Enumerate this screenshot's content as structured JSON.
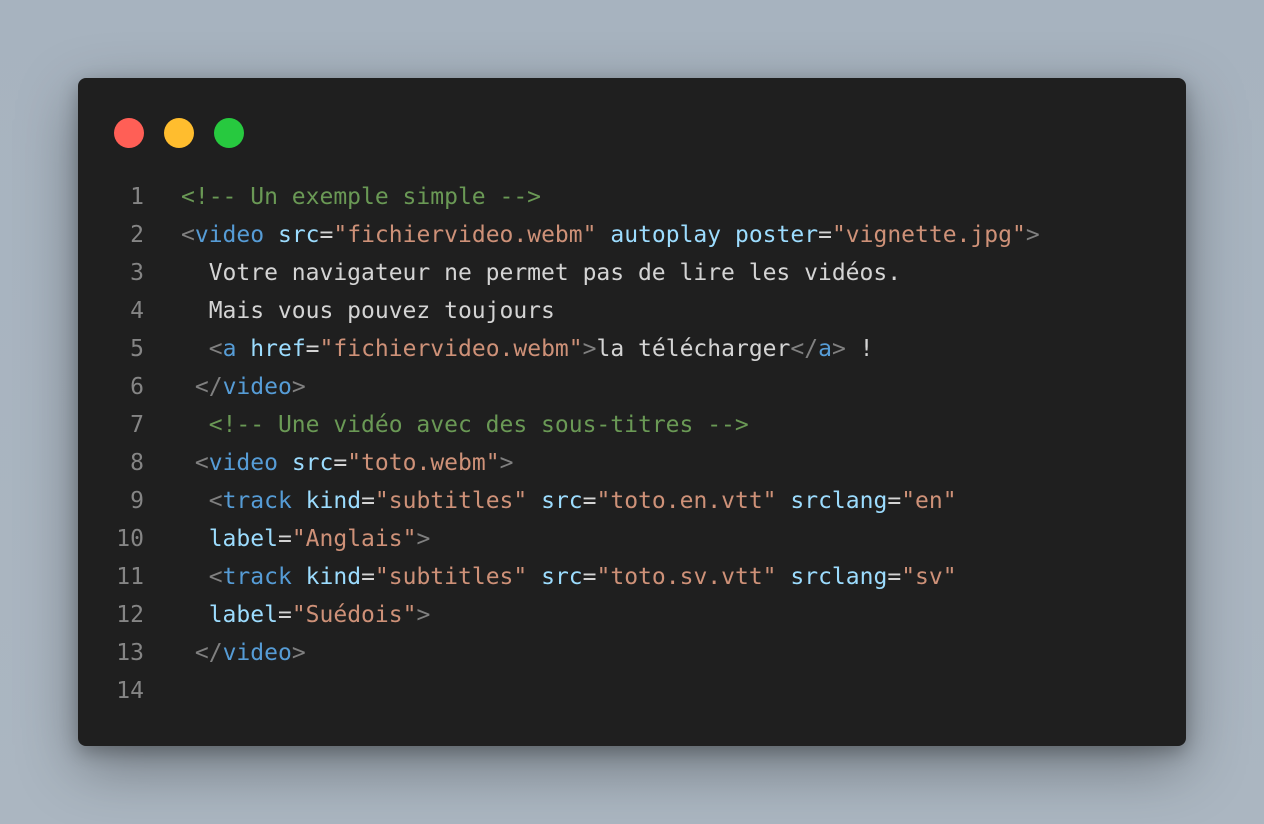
{
  "window": {
    "controls": [
      {
        "name": "close",
        "color": "#ff5f56"
      },
      {
        "name": "minimize",
        "color": "#ffbd2e"
      },
      {
        "name": "maximize",
        "color": "#27c93f"
      }
    ]
  },
  "colors": {
    "comment": "#6a9955",
    "punctuation": "#808080",
    "tag": "#569cd6",
    "attribute": "#9cdcfe",
    "string": "#ce9178",
    "text": "#d4d4d4",
    "line_number": "#858585",
    "editor_background": "#1f1f1f"
  },
  "code": {
    "lines": [
      {
        "number": "1",
        "tokens": [
          {
            "t": "comment",
            "v": "<!-- Un exemple simple -->"
          }
        ]
      },
      {
        "number": "2",
        "tokens": [
          {
            "t": "punct",
            "v": "<"
          },
          {
            "t": "tag",
            "v": "video"
          },
          {
            "t": "text",
            "v": " "
          },
          {
            "t": "attr",
            "v": "src"
          },
          {
            "t": "text",
            "v": "="
          },
          {
            "t": "str",
            "v": "\"fichiervideo.webm\""
          },
          {
            "t": "text",
            "v": " "
          },
          {
            "t": "attr",
            "v": "autoplay"
          },
          {
            "t": "text",
            "v": " "
          },
          {
            "t": "attr",
            "v": "poster"
          },
          {
            "t": "text",
            "v": "="
          },
          {
            "t": "str",
            "v": "\"vignette.jpg\""
          },
          {
            "t": "punct",
            "v": ">"
          }
        ]
      },
      {
        "number": "3",
        "tokens": [
          {
            "t": "text",
            "v": "  Votre navigateur ne permet pas de lire les vidéos."
          }
        ]
      },
      {
        "number": "4",
        "tokens": [
          {
            "t": "text",
            "v": "  Mais vous pouvez toujours"
          }
        ]
      },
      {
        "number": "5",
        "tokens": [
          {
            "t": "text",
            "v": "  "
          },
          {
            "t": "punct",
            "v": "<"
          },
          {
            "t": "tag",
            "v": "a"
          },
          {
            "t": "text",
            "v": " "
          },
          {
            "t": "attr",
            "v": "href"
          },
          {
            "t": "text",
            "v": "="
          },
          {
            "t": "str",
            "v": "\"fichiervideo.webm\""
          },
          {
            "t": "punct",
            "v": ">"
          },
          {
            "t": "text",
            "v": "la télécharger"
          },
          {
            "t": "punct",
            "v": "</"
          },
          {
            "t": "tag",
            "v": "a"
          },
          {
            "t": "punct",
            "v": ">"
          },
          {
            "t": "text",
            "v": " !"
          }
        ]
      },
      {
        "number": "6",
        "tokens": [
          {
            "t": "text",
            "v": " "
          },
          {
            "t": "punct",
            "v": "</"
          },
          {
            "t": "tag",
            "v": "video"
          },
          {
            "t": "punct",
            "v": ">"
          }
        ]
      },
      {
        "number": "7",
        "tokens": [
          {
            "t": "text",
            "v": "  "
          },
          {
            "t": "comment",
            "v": "<!-- Une vidéo avec des sous-titres -->"
          }
        ]
      },
      {
        "number": "8",
        "tokens": [
          {
            "t": "text",
            "v": " "
          },
          {
            "t": "punct",
            "v": "<"
          },
          {
            "t": "tag",
            "v": "video"
          },
          {
            "t": "text",
            "v": " "
          },
          {
            "t": "attr",
            "v": "src"
          },
          {
            "t": "text",
            "v": "="
          },
          {
            "t": "str",
            "v": "\"toto.webm\""
          },
          {
            "t": "punct",
            "v": ">"
          }
        ]
      },
      {
        "number": "9",
        "tokens": [
          {
            "t": "text",
            "v": "  "
          },
          {
            "t": "punct",
            "v": "<"
          },
          {
            "t": "tag",
            "v": "track"
          },
          {
            "t": "text",
            "v": " "
          },
          {
            "t": "attr",
            "v": "kind"
          },
          {
            "t": "text",
            "v": "="
          },
          {
            "t": "str",
            "v": "\"subtitles\""
          },
          {
            "t": "text",
            "v": " "
          },
          {
            "t": "attr",
            "v": "src"
          },
          {
            "t": "text",
            "v": "="
          },
          {
            "t": "str",
            "v": "\"toto.en.vtt\""
          },
          {
            "t": "text",
            "v": " "
          },
          {
            "t": "attr",
            "v": "srclang"
          },
          {
            "t": "text",
            "v": "="
          },
          {
            "t": "str",
            "v": "\"en\""
          }
        ]
      },
      {
        "number": "10",
        "tokens": [
          {
            "t": "text",
            "v": "  "
          },
          {
            "t": "attr",
            "v": "label"
          },
          {
            "t": "text",
            "v": "="
          },
          {
            "t": "str",
            "v": "\"Anglais\""
          },
          {
            "t": "punct",
            "v": ">"
          }
        ]
      },
      {
        "number": "11",
        "tokens": [
          {
            "t": "text",
            "v": "  "
          },
          {
            "t": "punct",
            "v": "<"
          },
          {
            "t": "tag",
            "v": "track"
          },
          {
            "t": "text",
            "v": " "
          },
          {
            "t": "attr",
            "v": "kind"
          },
          {
            "t": "text",
            "v": "="
          },
          {
            "t": "str",
            "v": "\"subtitles\""
          },
          {
            "t": "text",
            "v": " "
          },
          {
            "t": "attr",
            "v": "src"
          },
          {
            "t": "text",
            "v": "="
          },
          {
            "t": "str",
            "v": "\"toto.sv.vtt\""
          },
          {
            "t": "text",
            "v": " "
          },
          {
            "t": "attr",
            "v": "srclang"
          },
          {
            "t": "text",
            "v": "="
          },
          {
            "t": "str",
            "v": "\"sv\""
          }
        ]
      },
      {
        "number": "12",
        "tokens": [
          {
            "t": "text",
            "v": "  "
          },
          {
            "t": "attr",
            "v": "label"
          },
          {
            "t": "text",
            "v": "="
          },
          {
            "t": "str",
            "v": "\"Suédois\""
          },
          {
            "t": "punct",
            "v": ">"
          }
        ]
      },
      {
        "number": "13",
        "tokens": [
          {
            "t": "text",
            "v": " "
          },
          {
            "t": "punct",
            "v": "</"
          },
          {
            "t": "tag",
            "v": "video"
          },
          {
            "t": "punct",
            "v": ">"
          }
        ]
      },
      {
        "number": "14",
        "tokens": []
      }
    ]
  }
}
